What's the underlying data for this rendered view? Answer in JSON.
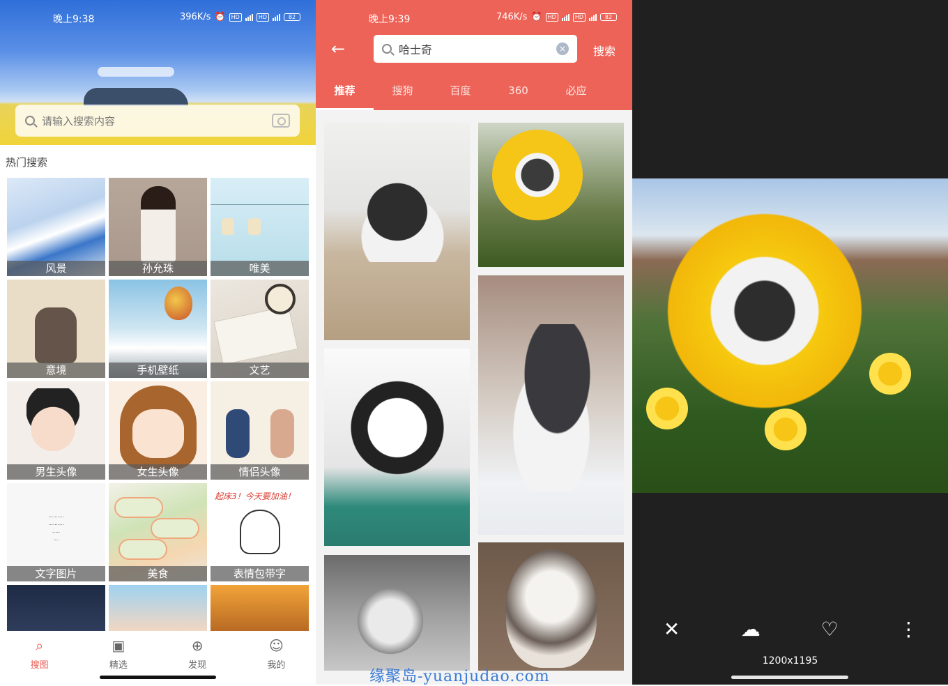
{
  "panel1": {
    "status": {
      "time": "晚上9:38",
      "speed": "396K/s",
      "battery": "82"
    },
    "search": {
      "placeholder": "请输入搜索内容"
    },
    "hot_title": "热门搜索",
    "categories": [
      "风景",
      "孙允珠",
      "唯美",
      "意境",
      "手机壁纸",
      "文艺",
      "男生头像",
      "女生头像",
      "情侣头像",
      "文字图片",
      "美食",
      "表情包带字"
    ],
    "meme_text": "起床3！今天要加油！",
    "tabs": [
      {
        "label": "搜图",
        "icon": "search-icon",
        "active": true
      },
      {
        "label": "精选",
        "icon": "image-icon",
        "active": false
      },
      {
        "label": "发现",
        "icon": "compass-icon",
        "active": false
      },
      {
        "label": "我的",
        "icon": "user-icon",
        "active": false
      }
    ],
    "accent": "#ec5d54"
  },
  "panel2": {
    "status": {
      "time": "晚上9:39",
      "speed": "746K/s",
      "battery": "82"
    },
    "search_value": "哈士奇",
    "search_button": "搜索",
    "engines": [
      "推荐",
      "搜狗",
      "百度",
      "360",
      "必应"
    ],
    "header_color": "#ee6358"
  },
  "panel3": {
    "dimensions": "1200x1195"
  },
  "watermark": "缘聚岛-yuanjudao.com"
}
